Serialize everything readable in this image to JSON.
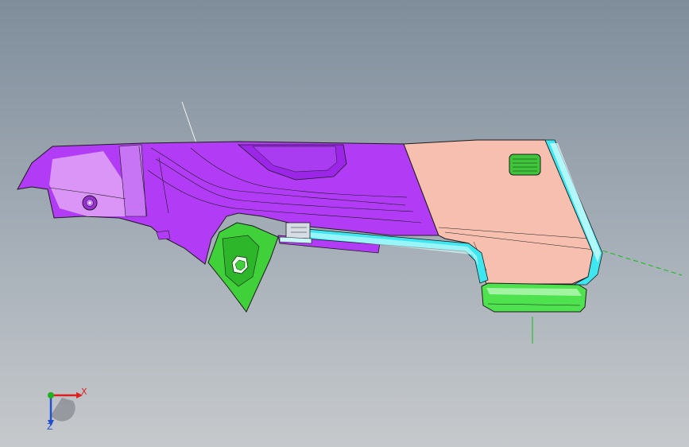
{
  "viewport": {
    "background_top": "#7f8d9b",
    "background_bottom": "#c6c9cc"
  },
  "model": {
    "colors": {
      "body_magenta": "#b23cf5",
      "body_highlight": "#e9b6f7",
      "panel_salmon": "#f6bfb0",
      "trim_cyan": "#3ee7ef",
      "pad_green": "#4ee24e",
      "bracket_green": "#3fd03a",
      "edge_line": "#1c1c1c"
    }
  },
  "triad": {
    "x_label": "X",
    "z_label": "Z",
    "x_color": "#e02020",
    "y_color": "#20b020",
    "z_color": "#2050d0"
  }
}
